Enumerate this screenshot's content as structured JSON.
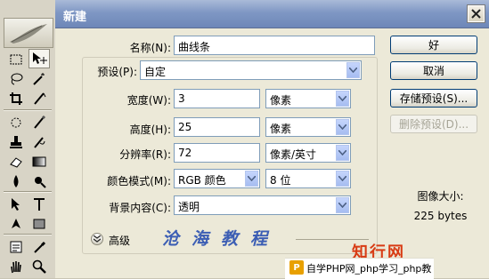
{
  "dialog": {
    "title": "新建",
    "name_label": "名称(N):",
    "name_value": "曲线条",
    "preset_label": "预设(P):",
    "preset_value": "自定",
    "width_label": "宽度(W):",
    "width_value": "3",
    "width_unit": "像素",
    "height_label": "高度(H):",
    "height_value": "25",
    "height_unit": "像素",
    "resolution_label": "分辨率(R):",
    "resolution_value": "72",
    "resolution_unit": "像素/英寸",
    "color_mode_label": "颜色模式(M):",
    "color_mode_value": "RGB 颜色",
    "bit_depth_value": "8 位",
    "background_label": "背景内容(C):",
    "background_value": "透明",
    "advanced_label": "高级",
    "image_size_label": "图像大小:",
    "image_size_value": "225 bytes"
  },
  "buttons": {
    "ok": "好",
    "cancel": "取消",
    "save_preset": "存储预设(S)...",
    "delete_preset": "删除预设(D)..."
  },
  "overlay": {
    "watermark": "沧海教程",
    "brand_top": "知行网",
    "brand_bottom": "自学PHP网_php学习_php教"
  },
  "icons": {
    "toolbox": [
      "marquee-icon",
      "move-icon",
      "lasso-icon",
      "magic-wand-icon",
      "crop-icon",
      "slice-icon",
      "healing-brush-icon",
      "brush-icon",
      "clone-stamp-icon",
      "history-brush-icon",
      "eraser-icon",
      "gradient-icon",
      "blur-icon",
      "dodge-icon",
      "path-selection-icon",
      "type-icon",
      "pen-icon",
      "shape-icon",
      "notes-icon",
      "eyedropper-icon",
      "hand-icon",
      "zoom-icon"
    ]
  },
  "colors": {
    "titlebar": "#7f97c4",
    "dialog_bg": "#ece9d8",
    "button_border": "#003c74",
    "watermark": "#3c5eb4",
    "brand": "#d83b14"
  }
}
